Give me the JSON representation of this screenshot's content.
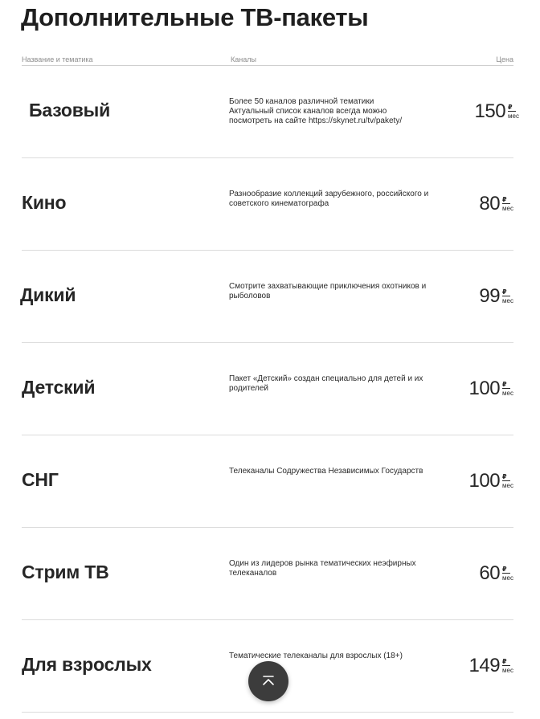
{
  "page": {
    "title": "Дополнительные ТВ-пакеты"
  },
  "table": {
    "headers": {
      "name": "Название и тематика",
      "channels": "Каналы",
      "price": "Цена"
    },
    "currency": "₽",
    "period": "мес",
    "rows": [
      {
        "name": "Базовый",
        "description": "Более 50 каналов различной тематики\nАктуальный список каналов всегда можно посмотреть на сайте https://skynet.ru/tv/pakety/",
        "price": "150"
      },
      {
        "name": "Кино",
        "description": "Разнообразие коллекций зарубежного, российского и советского кинематографа",
        "price": "80"
      },
      {
        "name": "Дикий",
        "description": "Смотрите захватывающие приключения охотников и рыболовов",
        "price": "99"
      },
      {
        "name": "Детский",
        "description": "Пакет «Детский» создан специально для детей и их родителей",
        "price": "100"
      },
      {
        "name": "СНГ",
        "description": "Телеканалы Содружества Независимых Государств",
        "price": "100"
      },
      {
        "name": "Стрим ТВ",
        "description": "Один из лидеров рынка тематических неэфирных телеканалов",
        "price": "60"
      },
      {
        "name": "Для взрослых",
        "description": "Тематические телеканалы для взрослых (18+)",
        "price": "149"
      }
    ]
  },
  "scroll_top": {
    "icon": "arrow-up-to-top-icon"
  }
}
